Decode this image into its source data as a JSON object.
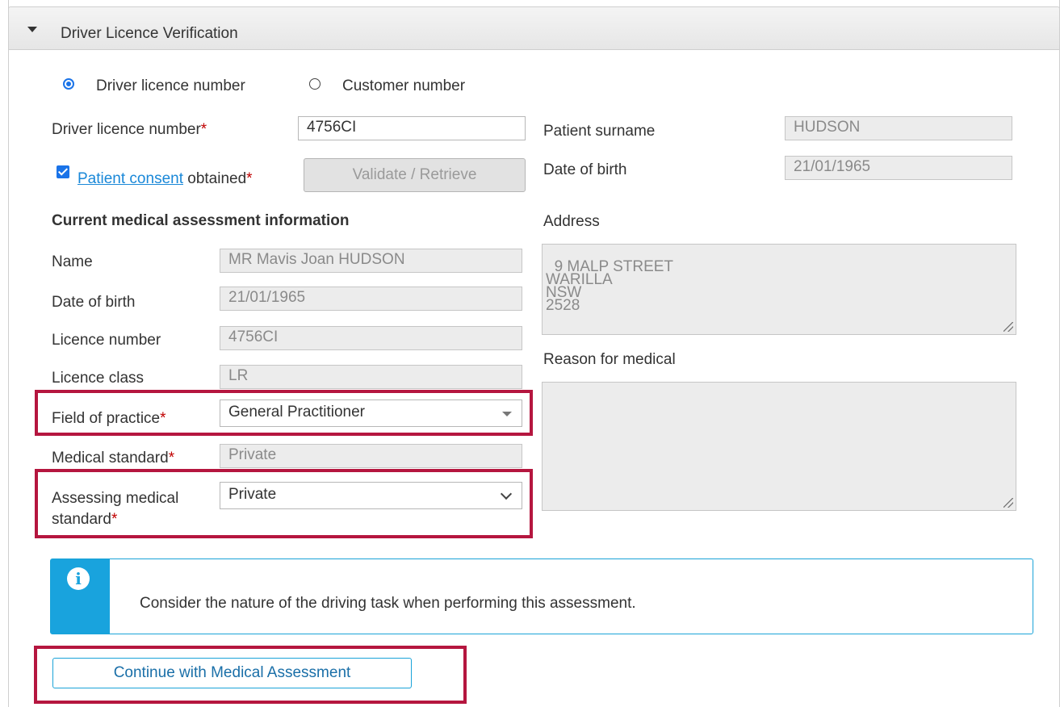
{
  "panel": {
    "title": "Driver Licence Verification"
  },
  "search_type": {
    "option1": "Driver licence number",
    "option2": "Customer number",
    "selected": "Driver licence number"
  },
  "left": {
    "dl_label": "Driver licence number",
    "dl_value": "4756CI",
    "consent_link": "Patient consent",
    "consent_rest": " obtained",
    "consent_checked": true,
    "validate_button": "Validate / Retrieve",
    "section_heading": "Current medical assessment information",
    "name_label": "Name",
    "name_value": "MR Mavis Joan HUDSON",
    "dob_label": "Date of birth",
    "dob_value": "21/01/1965",
    "licno_label": "Licence number",
    "licno_value": "4756CI",
    "class_label": "Licence class",
    "class_value": "LR",
    "field_label": "Field of practice",
    "field_value": "General Practitioner",
    "medstd_label": "Medical standard",
    "medstd_value": "Private",
    "assess_label_line1": "Assessing medical",
    "assess_label_line2": "standard",
    "assess_value": "Private",
    "required_mark": "*"
  },
  "right": {
    "surname_label": "Patient surname",
    "surname_value": "HUDSON",
    "dob_label": "Date of birth",
    "dob_value": "21/01/1965",
    "address_label": "Address",
    "address_value": "9 MALP STREET\nWARILLA\nNSW\n2528",
    "reason_label": "Reason for medical",
    "reason_value": ""
  },
  "info": {
    "message": "Consider the nature of the driving task when performing this assessment.",
    "icon": "info-icon"
  },
  "actions": {
    "continue_button": "Continue with Medical Assessment"
  },
  "colors": {
    "accent": "#1a73e8",
    "highlight": "#b5163f",
    "info": "#19a3dd",
    "required": "#c00000"
  }
}
